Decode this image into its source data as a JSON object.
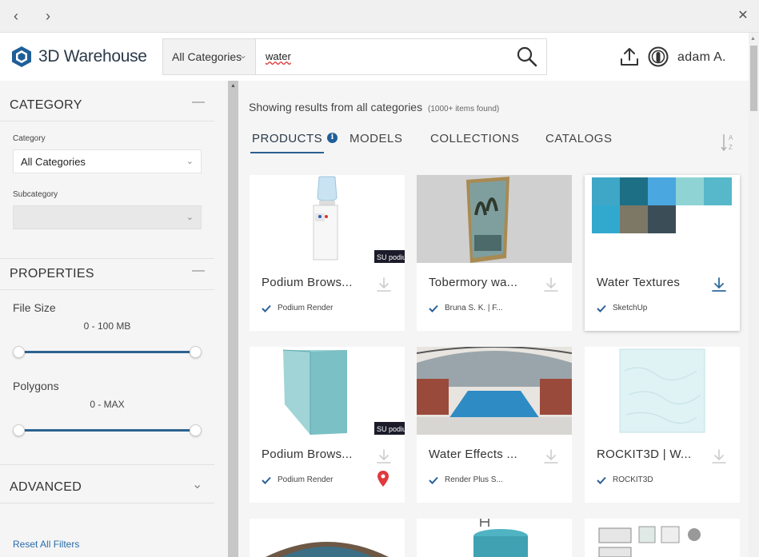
{
  "nav": {
    "back_glyph": "‹",
    "forward_glyph": "›",
    "close_glyph": "✕"
  },
  "header": {
    "logo_text": "3D Warehouse",
    "search_category": "All Categories",
    "search_value": "water",
    "username": "adam A."
  },
  "sidebar": {
    "category_title": "CATEGORY",
    "category_label": "Category",
    "category_value": "All Categories",
    "subcategory_label": "Subcategory",
    "subcategory_value": "",
    "properties_title": "PROPERTIES",
    "file_size_label": "File Size",
    "file_size_range": "0 - 100 MB",
    "polygons_label": "Polygons",
    "polygons_range": "0 - MAX",
    "advanced_title": "ADVANCED",
    "collapse_glyph": "—",
    "expand_glyph": "⌄",
    "reset_label": "Reset All Filters"
  },
  "main": {
    "results_text": "Showing results from all categories",
    "results_count": "(1000+ items found)",
    "tabs": [
      "PRODUCTS",
      "MODELS",
      "COLLECTIONS",
      "CATALOGS"
    ],
    "info_glyph": "i",
    "active_tab": "PRODUCTS"
  },
  "cards": [
    {
      "title": "Podium Brows...",
      "author": "Podium Render",
      "icon": "water-cooler"
    },
    {
      "title": "Tobermory wa...",
      "author": "Bruna S. K. | F...",
      "icon": "framed-painting"
    },
    {
      "title": "Water Textures",
      "author": "SketchUp",
      "icon": "texture-swatches"
    },
    {
      "title": "Podium Brows...",
      "author": "Podium Render",
      "icon": "glass-cube"
    },
    {
      "title": "Water Effects ...",
      "author": "Render Plus S...",
      "icon": "indoor-pool"
    },
    {
      "title": "ROCKIT3D | W...",
      "author": "ROCKIT3D",
      "icon": "water-texture"
    }
  ],
  "colors": {
    "accent": "#2b5f8e",
    "link": "#2a6ca8",
    "pin": "#e0393e"
  }
}
